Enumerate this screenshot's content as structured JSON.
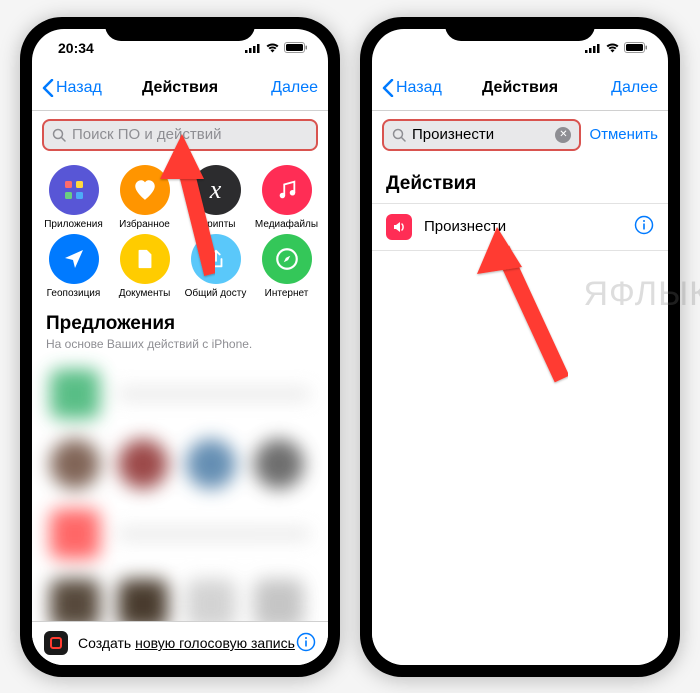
{
  "status": {
    "time": "20:34"
  },
  "nav": {
    "back": "Назад",
    "title": "Действия",
    "next": "Далее"
  },
  "left": {
    "search_placeholder": "Поиск ПО и действий",
    "categories": [
      {
        "label": "Приложения",
        "color": "#5856d6",
        "icon": "grid"
      },
      {
        "label": "Избранное",
        "color": "#ff9500",
        "icon": "heart"
      },
      {
        "label": "Скрипты",
        "color": "#2c2c2e",
        "icon": "script"
      },
      {
        "label": "Медиафайлы",
        "color": "#ff2d55",
        "icon": "music"
      },
      {
        "label": "Геопозиция",
        "color": "#007aff",
        "icon": "send"
      },
      {
        "label": "Документы",
        "color": "#ffcc00",
        "icon": "doc"
      },
      {
        "label": "Общий досту",
        "color": "#5ac8fa",
        "icon": "share"
      },
      {
        "label": "Интернет",
        "color": "#34c759",
        "icon": "compass"
      }
    ],
    "suggestions_title": "Предложения",
    "suggestions_sub": "На основе Ваших действий с iPhone.",
    "footer_prefix": "Создать ",
    "footer_underlined": "новую голосовую запись"
  },
  "right": {
    "search_value": "Произнести",
    "cancel": "Отменить",
    "results_header": "Действия",
    "result_label": "Произнести"
  },
  "watermark": "ЯФЛЫК"
}
